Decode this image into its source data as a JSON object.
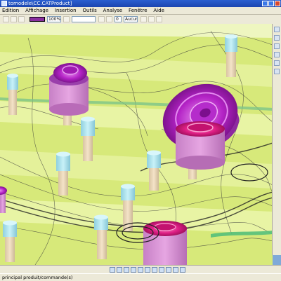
{
  "window": {
    "title": "tomodele\\CC.CATProduct]"
  },
  "menu": {
    "items": [
      "Edition",
      "Affichage",
      "Insertion",
      "Outils",
      "Analyse",
      "Fenêtre",
      "Aide"
    ]
  },
  "toolbar": {
    "color_label": "",
    "zoom_value": "100%",
    "field_value": "",
    "number_value": "0",
    "mode_value": "Aucun"
  },
  "status": {
    "text": "principal produit/commande(s)"
  },
  "colors": {
    "floor": "#dfee86",
    "floor_dark": "#c6d86a",
    "post": "#f0ddc0",
    "post_cap": "#a9e3ef",
    "magenta": "#c12fd0",
    "pink": "#e0208a",
    "pink_base": "#d878d0"
  },
  "icons": [
    "app-icon",
    "minimize-icon",
    "maximize-icon",
    "close-icon"
  ]
}
